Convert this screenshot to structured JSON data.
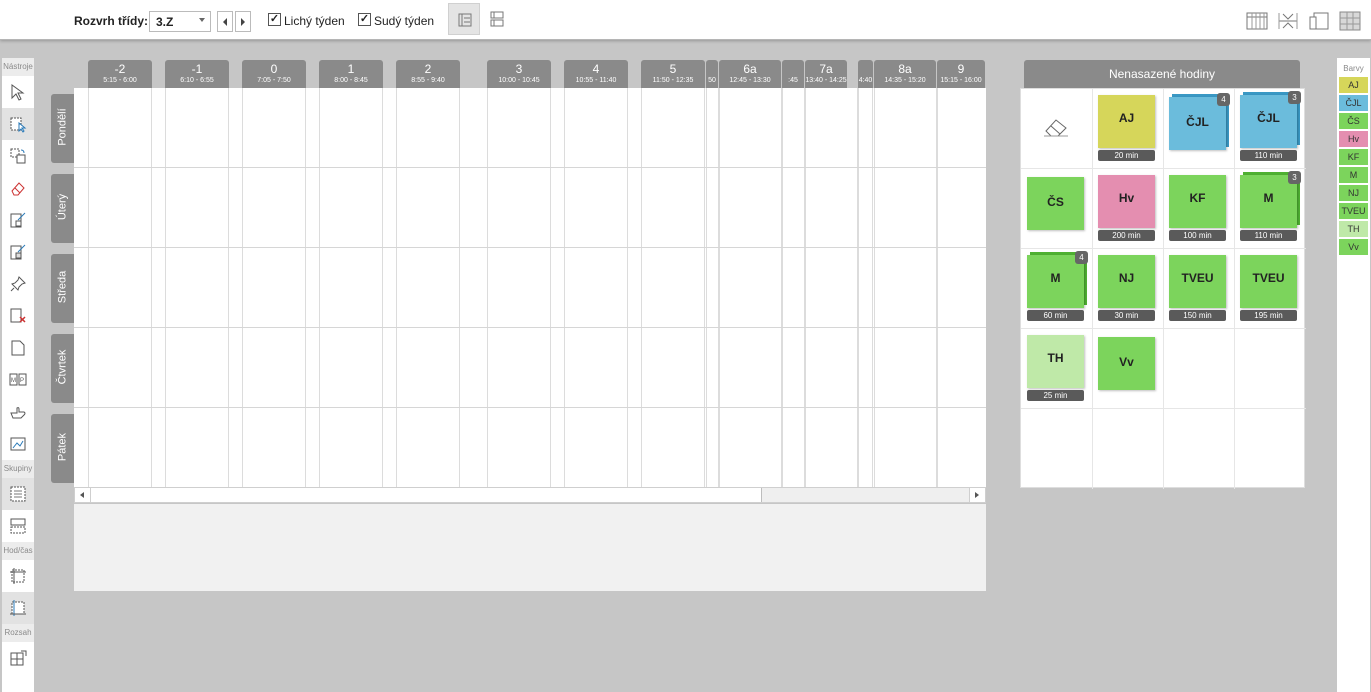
{
  "toolbar": {
    "class_label": "Rozvrh třídy:",
    "class_value": "3.Z",
    "odd_week_label": "Lichý týden",
    "odd_week_checked": true,
    "even_week_label": "Sudý týden",
    "even_week_checked": true
  },
  "left_tools": {
    "section_tools": "Nástroje",
    "section_groups": "Skupiny",
    "section_hour": "Hod/čas",
    "section_range": "Rozsah"
  },
  "schedule": {
    "slots": [
      {
        "num": "-2",
        "time": "5:15 - 6:00"
      },
      {
        "num": "-1",
        "time": "6:10 - 6:55"
      },
      {
        "num": "0",
        "time": "7:05 - 7:50"
      },
      {
        "num": "1",
        "time": "8:00 - 8:45"
      },
      {
        "num": "2",
        "time": "8:55 - 9:40"
      },
      {
        "num": "3",
        "time": "10:00 - 10:45"
      },
      {
        "num": "4",
        "time": "10:55 - 11:40"
      },
      {
        "num": "5",
        "time": "11:50 - 12:35"
      },
      {
        "num": "",
        "time": "50"
      },
      {
        "num": "6a",
        "time": "12:45 - 13:30"
      },
      {
        "num": "",
        "time": ":45"
      },
      {
        "num": "7a",
        "time": "13:40 - 14:25"
      },
      {
        "num": "",
        "time": "4:40"
      },
      {
        "num": "8a",
        "time": "14:35 - 15:20"
      },
      {
        "num": "9",
        "time": "15:15 - 16:00"
      }
    ],
    "days": [
      "Pondělí",
      "Úterý",
      "Středa",
      "Čtvrtek",
      "Pátek"
    ]
  },
  "unplaced": {
    "title": "Nenasazené hodiny",
    "cards": [
      {
        "label": "AJ",
        "duration": "20 min",
        "color": "#d6d65a",
        "count": ""
      },
      {
        "label": "ČJL",
        "duration": "",
        "color": "#6bbcdc",
        "count": "4"
      },
      {
        "label": "ČJL",
        "duration": "110 min",
        "color": "#6bbcdc",
        "count": "3"
      },
      {
        "label": "ČS",
        "duration": "",
        "color": "#7cd45c",
        "count": ""
      },
      {
        "label": "Hv",
        "duration": "200 min",
        "color": "#e48eb0",
        "count": ""
      },
      {
        "label": "KF",
        "duration": "100 min",
        "color": "#7cd45c",
        "count": ""
      },
      {
        "label": "M",
        "duration": "110 min",
        "color": "#7cd45c",
        "count": "3"
      },
      {
        "label": "M",
        "duration": "60 min",
        "color": "#7cd45c",
        "count": "4"
      },
      {
        "label": "NJ",
        "duration": "30 min",
        "color": "#7cd45c",
        "count": ""
      },
      {
        "label": "TVEU",
        "duration": "150 min",
        "color": "#7cd45c",
        "count": ""
      },
      {
        "label": "TVEU",
        "duration": "195 min",
        "color": "#7cd45c",
        "count": ""
      },
      {
        "label": "TH",
        "duration": "25 min",
        "color": "#bfe9a8",
        "count": ""
      },
      {
        "label": "Vv",
        "duration": "",
        "color": "#7cd45c",
        "count": ""
      }
    ]
  },
  "colors_panel": {
    "title": "Barvy",
    "items": [
      {
        "label": "AJ",
        "color": "#d6d65a"
      },
      {
        "label": "ČJL",
        "color": "#6bbcdc"
      },
      {
        "label": "ČS",
        "color": "#7cd45c"
      },
      {
        "label": "Hv",
        "color": "#e48eb0"
      },
      {
        "label": "KF",
        "color": "#7cd45c"
      },
      {
        "label": "M",
        "color": "#7cd45c"
      },
      {
        "label": "NJ",
        "color": "#7cd45c"
      },
      {
        "label": "TVEU",
        "color": "#7cd45c"
      },
      {
        "label": "TH",
        "color": "#bfe9a8"
      },
      {
        "label": "Vv",
        "color": "#7cd45c"
      }
    ]
  }
}
